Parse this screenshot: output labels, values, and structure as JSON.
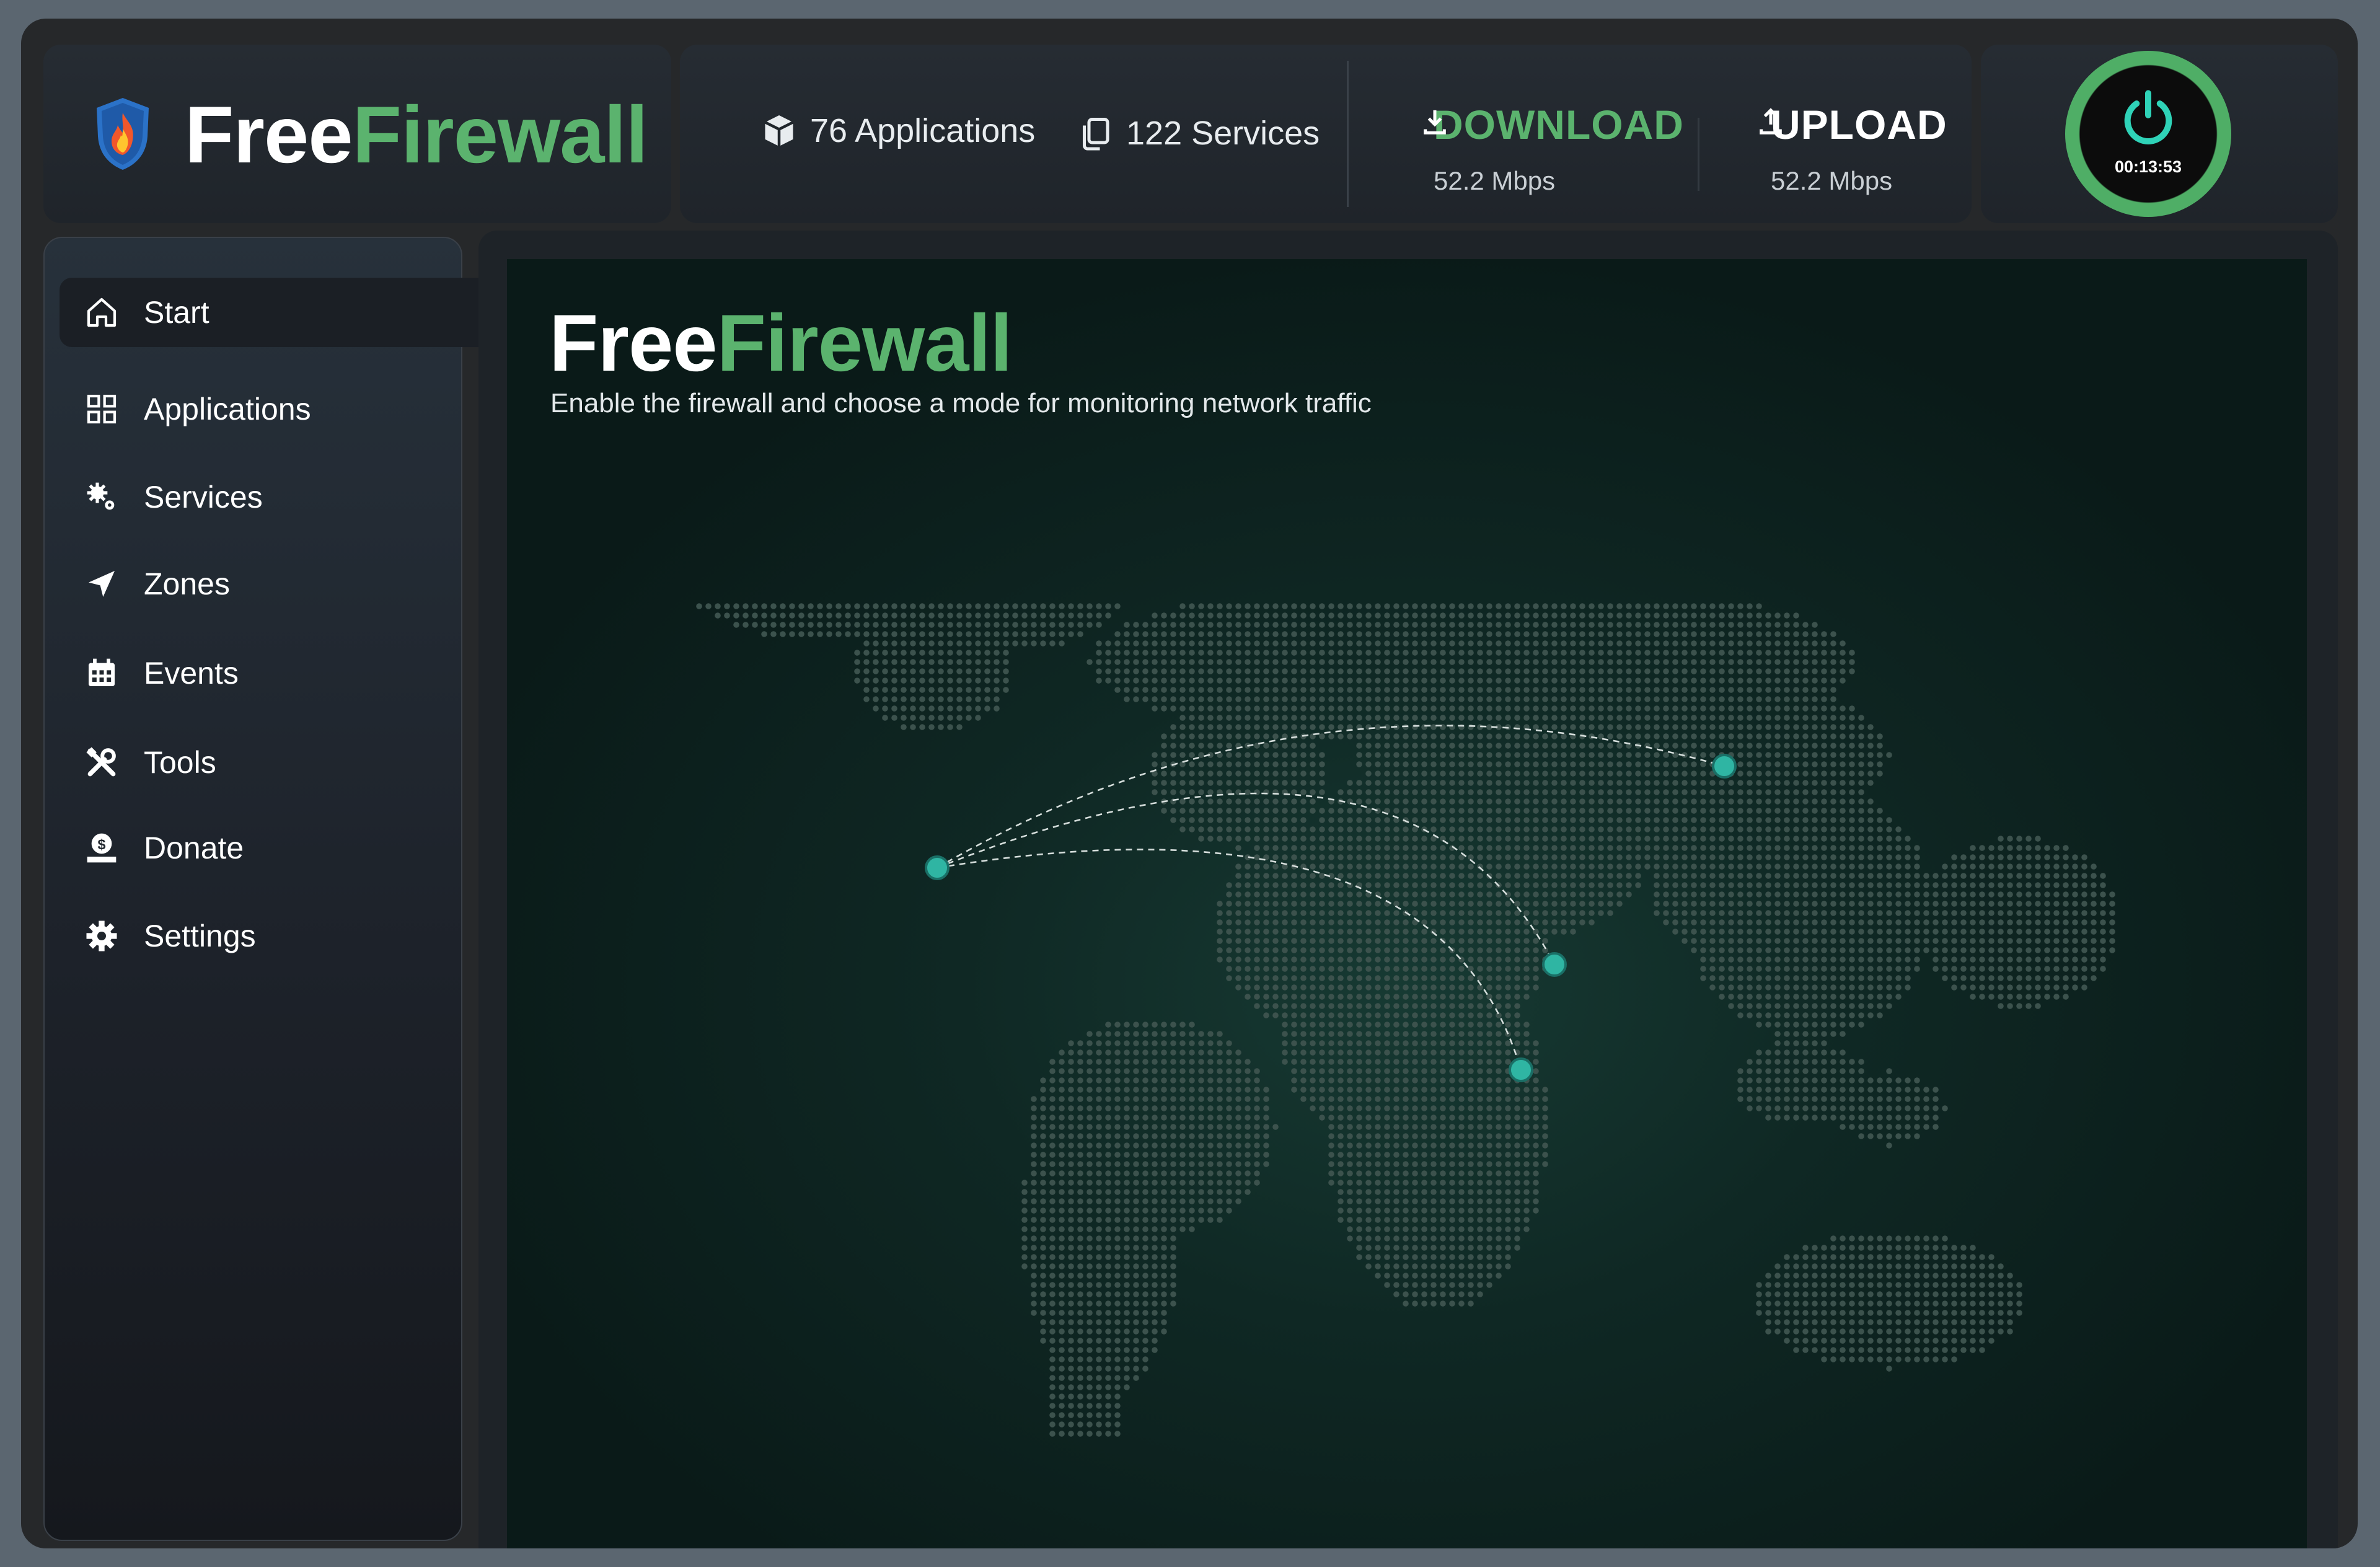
{
  "brand": {
    "part1": "Free",
    "part2": "Firewall"
  },
  "stats": {
    "applications": "76 Applications",
    "services": "122 Services"
  },
  "download": {
    "label": "DOWNLOAD",
    "value": "52.2 Mbps"
  },
  "upload": {
    "label": "UPLOAD",
    "value": "52.2 Mbps"
  },
  "power": {
    "timer": "00:13:53"
  },
  "sidebar": {
    "items": [
      {
        "label": "Start",
        "icon": "home-icon"
      },
      {
        "label": "Applications",
        "icon": "grid-icon"
      },
      {
        "label": "Services",
        "icon": "gears-icon"
      },
      {
        "label": "Zones",
        "icon": "send-icon"
      },
      {
        "label": "Events",
        "icon": "calendar-icon"
      },
      {
        "label": "Tools",
        "icon": "tools-icon"
      },
      {
        "label": "Donate",
        "icon": "donate-icon"
      },
      {
        "label": "Settings",
        "icon": "settings-icon"
      }
    ]
  },
  "main": {
    "title1": "Free",
    "title2": "Firewall",
    "subtitle": "Enable the firewall and choose a mode for monitoring network traffic",
    "map_title": ""
  },
  "colors": {
    "accent": "#5bb36e",
    "node": "#2fb5a3",
    "background": "#26282a"
  }
}
